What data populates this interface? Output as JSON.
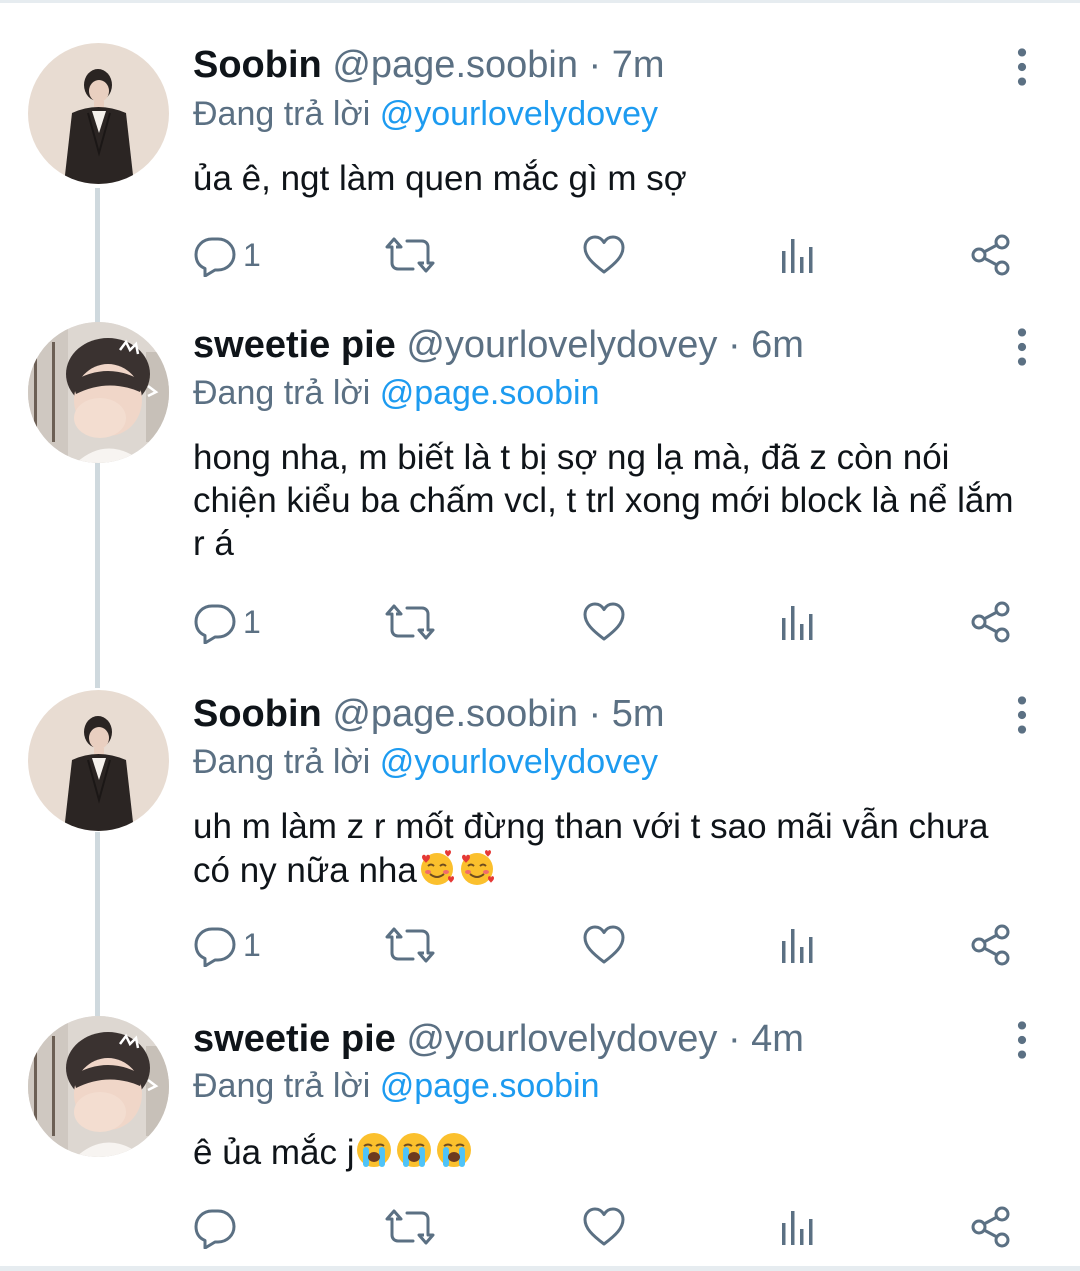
{
  "tweets": [
    {
      "name": "Soobin",
      "handle": "@page.soobin",
      "separator": "·",
      "time": "7m",
      "reply_prefix": "Đang trả lời",
      "reply_to": "@yourlovelydovey",
      "text": "ủa ê, ngt làm quen mắc gì m sợ",
      "reply_count": "1"
    },
    {
      "name": "sweetie pie",
      "handle": "@yourlovelydovey",
      "separator": "·",
      "time": "6m",
      "reply_prefix": "Đang trả lời",
      "reply_to": "@page.soobin",
      "text": "hong nha, m biết là t bị sợ ng lạ mà, đã z còn nói chiện kiểu ba chấm vcl, t trl xong mới block là nể lắm r á",
      "reply_count": "1"
    },
    {
      "name": "Soobin",
      "handle": "@page.soobin",
      "separator": "·",
      "time": "5m",
      "reply_prefix": "Đang trả lời",
      "reply_to": "@yourlovelydovey",
      "text": "uh m làm z r mốt đừng than với t sao mãi vẫn chưa có ny nữa nha",
      "reply_count": "1"
    },
    {
      "name": "sweetie pie",
      "handle": "@yourlovelydovey",
      "separator": "·",
      "time": "4m",
      "reply_prefix": "Đang trả lời",
      "reply_to": "@page.soobin",
      "text": "ê ủa mắc j",
      "reply_count": ""
    }
  ],
  "icons": {
    "reply": "reply-icon",
    "retweet": "retweet-icon",
    "like": "heart-icon",
    "analytics": "analytics-icon",
    "share": "share-icon",
    "more": "more-vertical-icon"
  },
  "colors": {
    "link": "#1d9bf0",
    "secondary": "#5b7083",
    "text": "#0f1419",
    "thread_line": "#cfd9de"
  }
}
